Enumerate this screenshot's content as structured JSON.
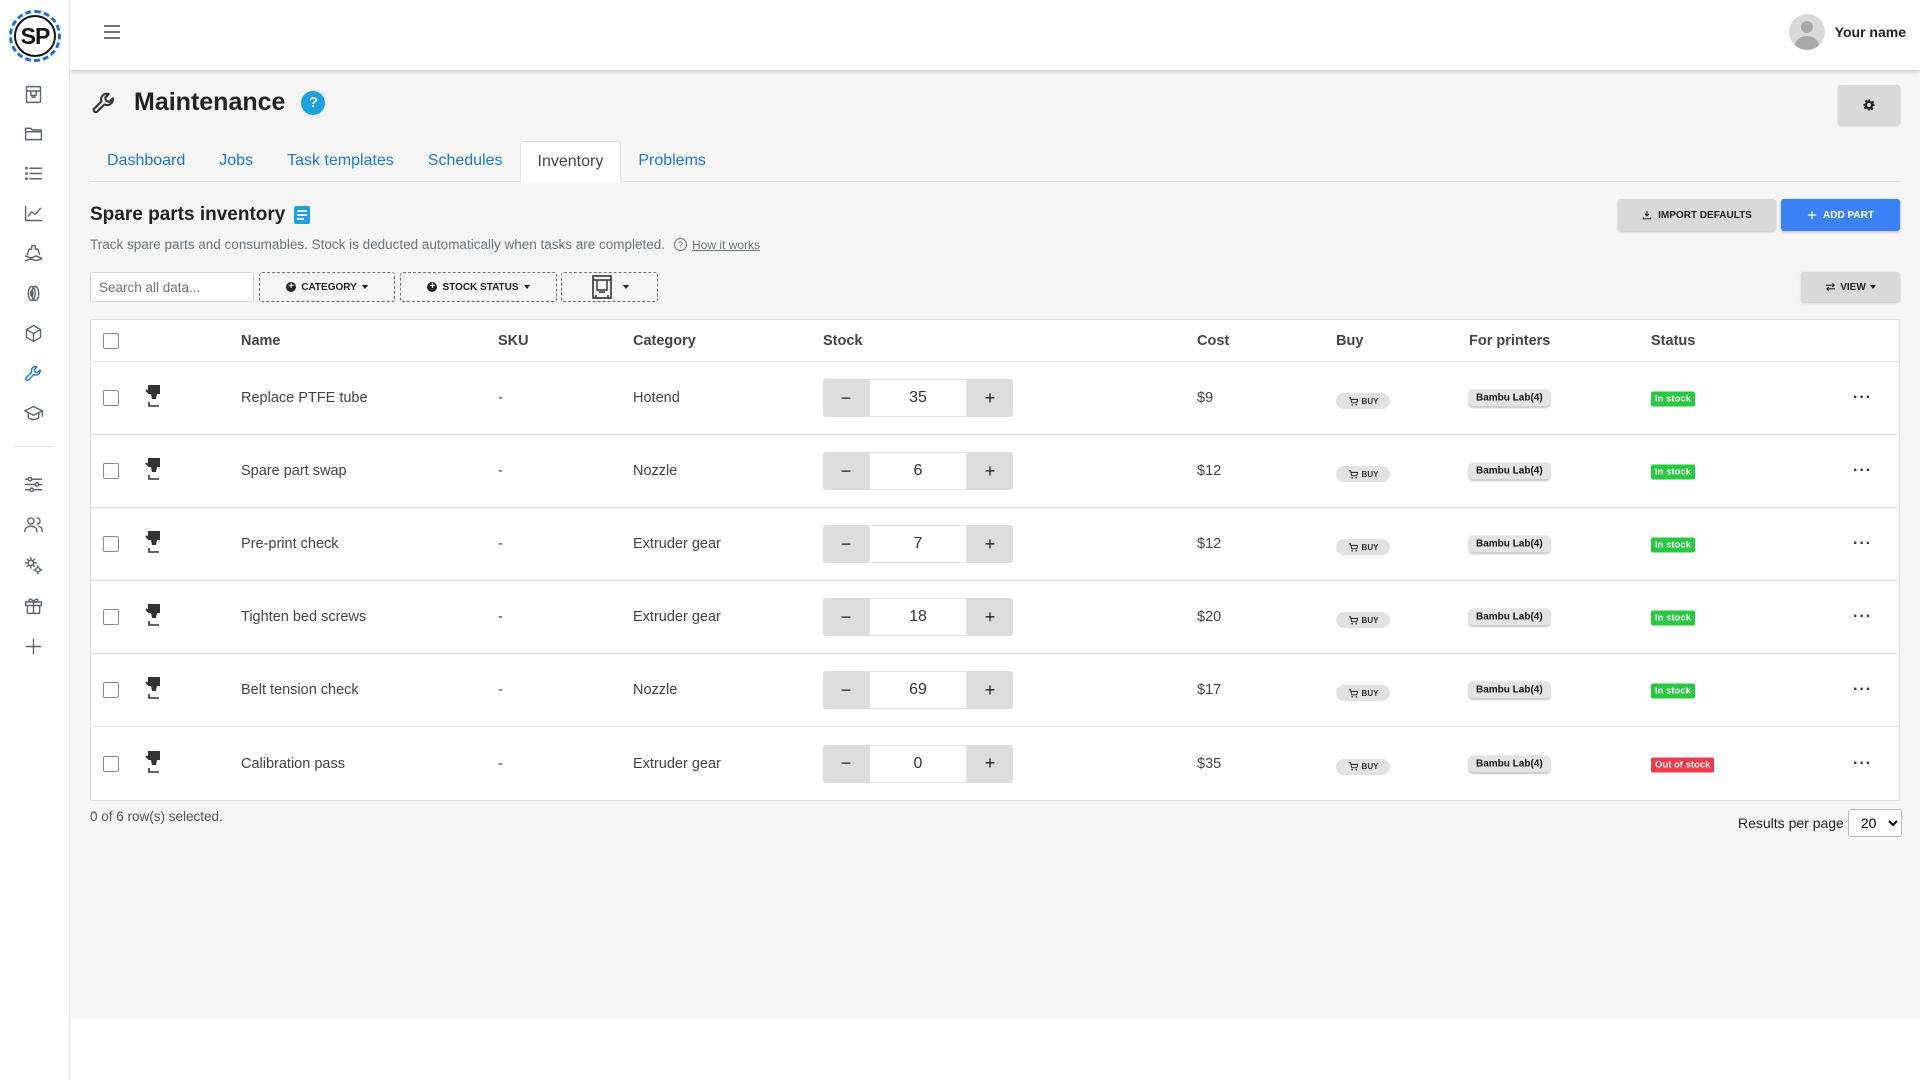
{
  "app": {
    "logo_text": "SP"
  },
  "sidebar": {
    "items": [
      {
        "name": "printer-icon"
      },
      {
        "name": "folder-icon"
      },
      {
        "name": "list-icon"
      },
      {
        "name": "chart-icon"
      },
      {
        "name": "ship-icon"
      },
      {
        "name": "filament-icon"
      },
      {
        "name": "box-icon"
      },
      {
        "name": "wrench-icon",
        "active": true
      },
      {
        "name": "graduation-icon"
      },
      {
        "name": "sliders-icon"
      },
      {
        "name": "users-icon"
      },
      {
        "name": "gears-icon"
      },
      {
        "name": "gift-icon"
      },
      {
        "name": "plus-icon"
      }
    ]
  },
  "topbar": {
    "user_name": "Your name"
  },
  "page": {
    "title": "Maintenance",
    "help": "?",
    "tabs": [
      "Dashboard",
      "Jobs",
      "Task templates",
      "Schedules",
      "Inventory",
      "Problems"
    ],
    "active_tab": "Inventory"
  },
  "section": {
    "title": "Spare parts inventory",
    "description": "Track spare parts and consumables. Stock is deducted automatically when tasks are completed.",
    "how_link": "How it works",
    "import_label": "IMPORT DEFAULTS",
    "add_label": "ADD PART"
  },
  "toolbar": {
    "search_placeholder": "Search all data...",
    "category_label": "CATEGORY",
    "stock_status_label": "STOCK STATUS",
    "view_label": "VIEW"
  },
  "table": {
    "columns": [
      "Name",
      "SKU",
      "Category",
      "Stock",
      "Cost",
      "Buy",
      "For printers",
      "Status"
    ],
    "buy_label": "BUY",
    "rows": [
      {
        "name": "Replace PTFE tube",
        "sku": "-",
        "category": "Hotend",
        "stock": "35",
        "cost": "$9",
        "printers": "Bambu Lab(4)",
        "status": "In stock",
        "status_color": "#28c840"
      },
      {
        "name": "Spare part swap",
        "sku": "-",
        "category": "Nozzle",
        "stock": "6",
        "cost": "$12",
        "printers": "Bambu Lab(4)",
        "status": "In stock",
        "status_color": "#28c840"
      },
      {
        "name": "Pre-print check",
        "sku": "-",
        "category": "Extruder gear",
        "stock": "7",
        "cost": "$12",
        "printers": "Bambu Lab(4)",
        "status": "In stock",
        "status_color": "#28c840"
      },
      {
        "name": "Tighten bed screws",
        "sku": "-",
        "category": "Extruder gear",
        "stock": "18",
        "cost": "$20",
        "printers": "Bambu Lab(4)",
        "status": "In stock",
        "status_color": "#28c840"
      },
      {
        "name": "Belt tension check",
        "sku": "-",
        "category": "Nozzle",
        "stock": "69",
        "cost": "$17",
        "printers": "Bambu Lab(4)",
        "status": "In stock",
        "status_color": "#28c840"
      },
      {
        "name": "Calibration pass",
        "sku": "-",
        "category": "Extruder gear",
        "stock": "0",
        "cost": "$35",
        "printers": "Bambu Lab(4)",
        "status": "Out of stock",
        "status_color": "#ef3b4c"
      }
    ]
  },
  "footer": {
    "selection_text": "0 of 6 row(s) selected.",
    "results_label": "Results per page",
    "results_value": "20"
  },
  "colors": {
    "accent": "#1f78d1",
    "primary_button": "#3b82f6",
    "in_stock": "#28c840",
    "out_of_stock": "#ef3b4c"
  }
}
